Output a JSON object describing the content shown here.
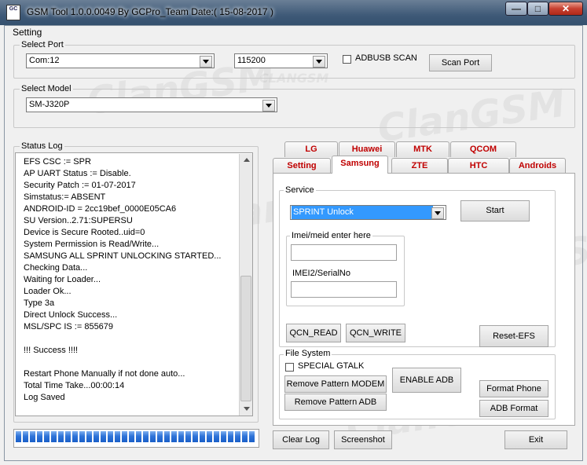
{
  "window": {
    "title": "GSM Tool 1.0.0.0049 By GCPro_Team  Date:( 15-08-2017 )",
    "icon_text": "GC"
  },
  "menu": {
    "setting": "Setting"
  },
  "select_port": {
    "label": "Select Port",
    "port_value": "Com:12",
    "baud_value": "115200",
    "adbusb_scan_label": "ADBUSB SCAN",
    "scan_port_button": "Scan Port"
  },
  "select_model": {
    "label": "Select Model",
    "value": "SM-J320P"
  },
  "status_log": {
    "label": "Status Log",
    "lines": [
      "EFS CSC := SPR",
      "AP UART Status := Disable.",
      "Security Patch := 01-07-2017",
      "Simstatus:= ABSENT",
      "ANDROID-ID = 2cc19bef_0000E05CA6",
      "SU Version..2.71:SUPERSU",
      "Device is Secure Rooted..uid=0",
      "System Permission is Read/Write...",
      "SAMSUNG ALL SPRINT UNLOCKING STARTED...",
      "Checking Data...",
      "Waiting for Loader...",
      "Loader Ok...",
      "Type 3a",
      "Direct Unlock Success...",
      "MSL/SPC IS := 855679",
      "",
      "!!! Success !!!!",
      "",
      "Restart Phone Manually if not done auto...",
      "Total Time Take...00:00:14",
      "Log Saved"
    ]
  },
  "tabs": {
    "row1": [
      "LG",
      "Huawei",
      "MTK",
      "QCOM"
    ],
    "row2": [
      "Setting",
      "Samsung",
      "ZTE",
      "HTC",
      "Androids"
    ],
    "active": "Samsung"
  },
  "service": {
    "label": "Service",
    "value": "SPRINT Unlock",
    "start_button": "Start",
    "imei_label": "Imei/meid enter here",
    "imei2_label": "IMEI2/SerialNo",
    "qcn_read": "QCN_READ",
    "qcn_write": "QCN_WRITE",
    "reset_efs": "Reset-EFS"
  },
  "file_system": {
    "label": "File System",
    "special_gtalk": "SPECIAL GTALK",
    "remove_pattern_modem": "Remove Pattern MODEM",
    "enable_adb": "ENABLE ADB",
    "remove_pattern_adb": "Remove Pattern ADB",
    "format_phone": "Format Phone",
    "adb_format": "ADB Format"
  },
  "bottom": {
    "clear_log": "Clear Log",
    "screenshot": "Screenshot",
    "exit": "Exit",
    "progress_fraction": 1.0
  },
  "watermark": {
    "big": "ClanGSM",
    "small": "CLANGSM"
  },
  "colors": {
    "tab_text": "#c00000",
    "selected_item": "#3399ff",
    "progress": "#2f74d8"
  }
}
